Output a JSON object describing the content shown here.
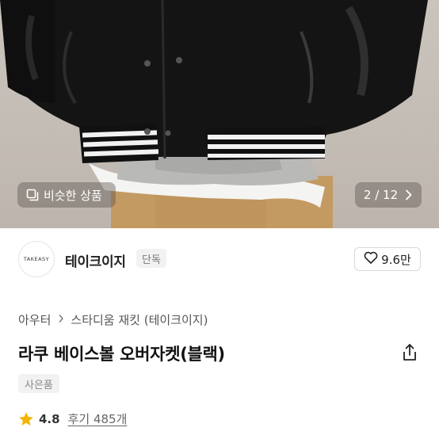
{
  "hero": {
    "similar_label": "비슷한 상품",
    "page_current": "2",
    "page_sep": "/",
    "page_total": "12"
  },
  "brand": {
    "logo_text": "TAKEASY",
    "name": "테이크이지",
    "badge": "단독",
    "likes": "9.6만"
  },
  "breadcrumb": {
    "items": [
      "아우터",
      "스타디움 재킷 (테이크이지)"
    ]
  },
  "product": {
    "title": "라쿠 베이스볼 오버자켓(블랙)",
    "gift_badge": "사은품",
    "rating": "4.8",
    "reviews_label": "후기 485개"
  },
  "colors": {
    "star": "#f5b400",
    "jacket": "#141414",
    "pants": "#c49a63"
  },
  "icons": [
    "similar-items-icon",
    "chevron-right-icon",
    "heart-icon",
    "share-icon",
    "star-icon"
  ]
}
